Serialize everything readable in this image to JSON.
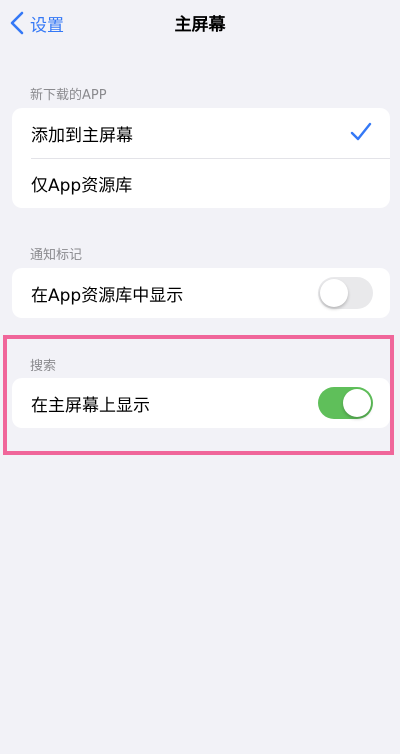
{
  "navbar": {
    "back_label": "设置",
    "title": "主屏幕"
  },
  "sections": {
    "download": {
      "header": "新下载的APP",
      "options": [
        {
          "label": "添加到主屏幕",
          "selected": true
        },
        {
          "label": "仅App资源库",
          "selected": false
        }
      ]
    },
    "notification": {
      "header": "通知标记",
      "row_label": "在App资源库中显示",
      "toggle_on": false
    },
    "search": {
      "header": "搜索",
      "row_label": "在主屏幕上显示",
      "toggle_on": true
    }
  },
  "colors": {
    "accent": "#3478f6",
    "toggle_on": "#5fbf5a",
    "highlight": "#f0669a",
    "background": "#f2f2f7"
  }
}
